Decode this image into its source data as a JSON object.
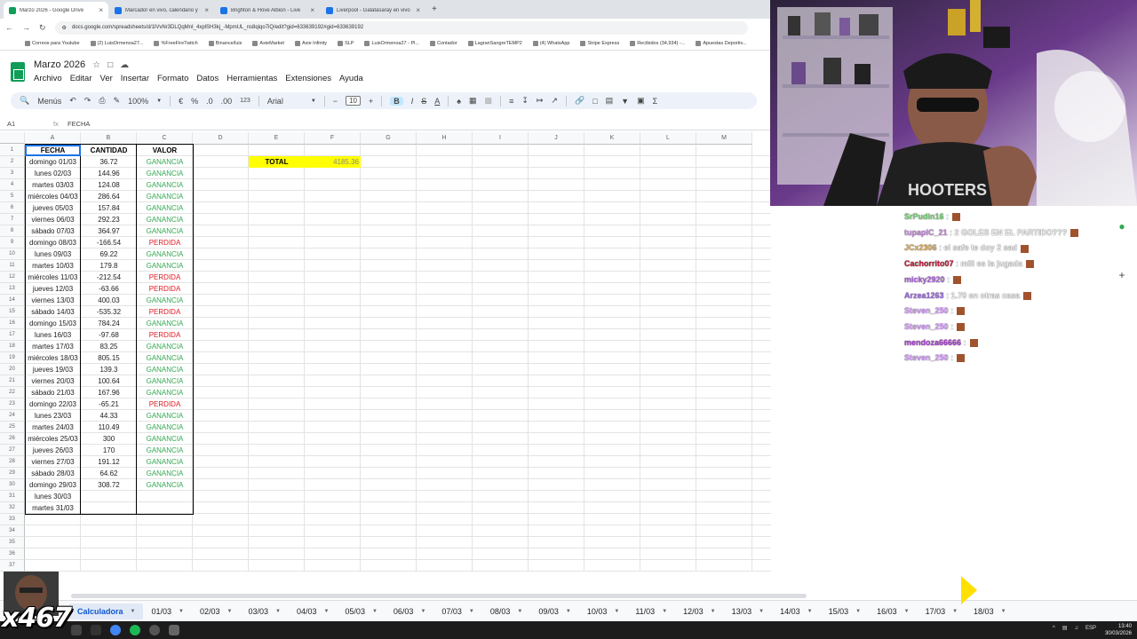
{
  "browser": {
    "tabs": [
      {
        "title": "Marzo 2026 - Google Drive",
        "color": "#0f9d58"
      },
      {
        "title": "Marcador en vivo, calendario y",
        "color": "#1a73e8"
      },
      {
        "title": "Brighton & Hove Albion - Live",
        "color": "#1a73e8"
      },
      {
        "title": "Liverpool - Galatasaray en vivo",
        "color": "#1a73e8"
      }
    ],
    "url": "docs.google.com/spreadsheets/d/1lVvNr3DLQqMnI_4xplSH3kj_-MpmUL_ns8qiqo7iQ/edit?gid=633639192#gid=633639192",
    "bookmarks": [
      "Correos para Youtube",
      "(2) LuisOrmenoa27...",
      "%FreeFireTwitch",
      "Binance/luis",
      "AxieMarket",
      "Axie Infinity",
      "SLP",
      "LuisOrmenoa27 - Pl...",
      "Contador",
      "LagranSangreTEMP2",
      "(4) WhatsApp",
      "Stripe Express",
      "Recibidos (34,934) -...",
      "Apuestas Deportiv..."
    ]
  },
  "doc": {
    "title": "Marzo 2026",
    "menus": [
      "Archivo",
      "Editar",
      "Ver",
      "Insertar",
      "Formato",
      "Datos",
      "Herramientas",
      "Extensiones",
      "Ayuda"
    ]
  },
  "toolbar": {
    "menus_label": "Menús",
    "zoom": "100%",
    "currency": "€",
    "percent": "%",
    "dec_less": ".0",
    "dec_more": ".00",
    "number_format": "123",
    "font": "Arial",
    "font_size": "10",
    "bold": "B",
    "italic": "I",
    "strike": "S",
    "textcolor": "A",
    "sum": "Σ"
  },
  "formula_bar": {
    "cell_ref": "A1",
    "fx": "fx",
    "content": "FECHA"
  },
  "columns": [
    "A",
    "B",
    "C",
    "D",
    "E",
    "F",
    "G",
    "H",
    "I",
    "J",
    "K",
    "L",
    "M"
  ],
  "headers": {
    "fecha": "FECHA",
    "cantidad": "CANTIDAD",
    "valor": "VALOR"
  },
  "total": {
    "label": "TOTAL",
    "value": "4185.36"
  },
  "rows": [
    {
      "fecha": "domingo 01/03",
      "cantidad": "36.72",
      "valor": "GANANCIA"
    },
    {
      "fecha": "lunes 02/03",
      "cantidad": "144.96",
      "valor": "GANANCIA"
    },
    {
      "fecha": "martes 03/03",
      "cantidad": "124.08",
      "valor": "GANANCIA"
    },
    {
      "fecha": "miércoles 04/03",
      "cantidad": "286.64",
      "valor": "GANANCIA"
    },
    {
      "fecha": "jueves 05/03",
      "cantidad": "157.84",
      "valor": "GANANCIA"
    },
    {
      "fecha": "viernes 06/03",
      "cantidad": "292.23",
      "valor": "GANANCIA"
    },
    {
      "fecha": "sábado 07/03",
      "cantidad": "364.97",
      "valor": "GANANCIA"
    },
    {
      "fecha": "domingo 08/03",
      "cantidad": "-166.54",
      "valor": "PERDIDA"
    },
    {
      "fecha": "lunes 09/03",
      "cantidad": "69.22",
      "valor": "GANANCIA"
    },
    {
      "fecha": "martes 10/03",
      "cantidad": "179.8",
      "valor": "GANANCIA"
    },
    {
      "fecha": "miércoles 11/03",
      "cantidad": "-212.54",
      "valor": "PERDIDA"
    },
    {
      "fecha": "jueves 12/03",
      "cantidad": "-63.66",
      "valor": "PERDIDA"
    },
    {
      "fecha": "viernes 13/03",
      "cantidad": "400.03",
      "valor": "GANANCIA"
    },
    {
      "fecha": "sábado 14/03",
      "cantidad": "-535.32",
      "valor": "PERDIDA"
    },
    {
      "fecha": "domingo 15/03",
      "cantidad": "784.24",
      "valor": "GANANCIA"
    },
    {
      "fecha": "lunes 16/03",
      "cantidad": "-97.68",
      "valor": "PERDIDA"
    },
    {
      "fecha": "martes 17/03",
      "cantidad": "83.25",
      "valor": "GANANCIA"
    },
    {
      "fecha": "miércoles 18/03",
      "cantidad": "805.15",
      "valor": "GANANCIA"
    },
    {
      "fecha": "jueves 19/03",
      "cantidad": "139.3",
      "valor": "GANANCIA"
    },
    {
      "fecha": "viernes 20/03",
      "cantidad": "100.64",
      "valor": "GANANCIA"
    },
    {
      "fecha": "sábado 21/03",
      "cantidad": "167.96",
      "valor": "GANANCIA"
    },
    {
      "fecha": "domingo 22/03",
      "cantidad": "-65.21",
      "valor": "PERDIDA"
    },
    {
      "fecha": "lunes 23/03",
      "cantidad": "44.33",
      "valor": "GANANCIA"
    },
    {
      "fecha": "martes 24/03",
      "cantidad": "110.49",
      "valor": "GANANCIA"
    },
    {
      "fecha": "miércoles 25/03",
      "cantidad": "300",
      "valor": "GANANCIA"
    },
    {
      "fecha": "jueves 26/03",
      "cantidad": "170",
      "valor": "GANANCIA"
    },
    {
      "fecha": "viernes 27/03",
      "cantidad": "191.12",
      "valor": "GANANCIA"
    },
    {
      "fecha": "sábado 28/03",
      "cantidad": "64.62",
      "valor": "GANANCIA"
    },
    {
      "fecha": "domingo 29/03",
      "cantidad": "308.72",
      "valor": "GANANCIA"
    },
    {
      "fecha": "lunes 30/03",
      "cantidad": "",
      "valor": ""
    },
    {
      "fecha": "martes 31/03",
      "cantidad": "",
      "valor": ""
    }
  ],
  "row_count": 37,
  "sheet_tabs": [
    "Calculadora",
    "01/03",
    "02/03",
    "03/03",
    "04/03",
    "05/03",
    "06/03",
    "07/03",
    "08/03",
    "09/03",
    "10/03",
    "11/03",
    "12/03",
    "13/03",
    "14/03",
    "15/03",
    "16/03",
    "17/03",
    "18/03"
  ],
  "active_sheet": "Calculadora",
  "chat": [
    {
      "user": "SrPudin16",
      "text": ":",
      "color": "#7cd67c"
    },
    {
      "user": "tupapIC_21",
      "text": ": 2 GOLES EN EL PARTIDO???",
      "color": "#c98ee0"
    },
    {
      "user": "JCx2306",
      "text": ": el safe te doy 2 sad",
      "color": "#e0b060"
    },
    {
      "user": "Cachorrito07",
      "text": ": mill es la jugada",
      "color": "#c81e3c"
    },
    {
      "user": "micky2920",
      "text": ":",
      "color": "#b06ae0"
    },
    {
      "user": "Arzea1263",
      "text": ": 1.70 en otras casa",
      "color": "#a070e0"
    },
    {
      "user": "Steven_250",
      "text": ":",
      "color": "#d9a0ff"
    },
    {
      "user": "Steven_250",
      "text": ":",
      "color": "#d9a0ff"
    },
    {
      "user": "mendoza66666",
      "text": ":",
      "color": "#b040d8"
    },
    {
      "user": "Steven_250",
      "text": ":",
      "color": "#d9a0ff"
    }
  ],
  "overlay": {
    "counter": "x467"
  },
  "system": {
    "lang": "ESP",
    "time": "13:40",
    "date": "30/03/2026"
  },
  "colors": {
    "gain": "#34a853",
    "loss": "#e01b24",
    "total_bg": "#ffff00",
    "sheets_green": "#0f9d58"
  }
}
